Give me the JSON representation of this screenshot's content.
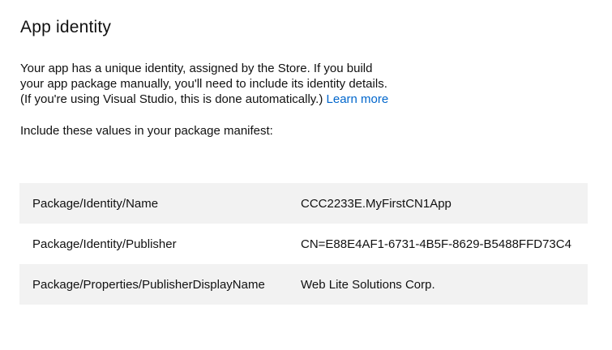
{
  "page": {
    "title": "App identity",
    "intro": {
      "line1": "Your app has a unique identity, assigned by the Store. If you build",
      "line2": "your app package manually, you'll need to include its identity details.",
      "line3": "(If you're using Visual Studio, this is done automatically.)",
      "link_label": "Learn more"
    },
    "manifest_instruction": "Include these values in your package manifest:",
    "colors": {
      "link": "#0066cc",
      "row_alt_bg": "#f2f2f2"
    }
  },
  "manifest_table": {
    "rows": [
      {
        "key": "Package/Identity/Name",
        "value": "CCC2233E.MyFirstCN1App"
      },
      {
        "key": "Package/Identity/Publisher",
        "value": "CN=E88E4AF1-6731-4B5F-8629-B5488FFD73C4"
      },
      {
        "key": "Package/Properties/PublisherDisplayName",
        "value": "Web Lite Solutions Corp."
      }
    ]
  }
}
